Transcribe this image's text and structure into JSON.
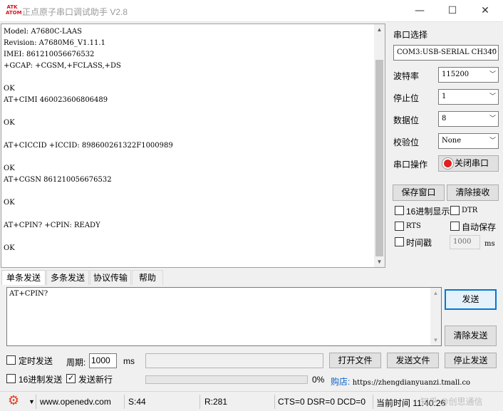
{
  "window": {
    "logo_text": "ATK ATOM",
    "title": "正点原子串口调试助手 V2.8",
    "minimize_icon": "minimize-icon",
    "maximize_icon": "maximize-icon",
    "close_icon": "close-icon"
  },
  "receive": {
    "lines": [
      "Model: A7680C-LAAS",
      "Revision: A7680M6_V1.11.1",
      "IMEI: 861210056676532",
      "+GCAP: +CGSM,+FCLASS,+DS",
      "",
      "OK",
      "AT+CIMI 460023606806489",
      "",
      "OK",
      "",
      "AT+CICCID +ICCID: 898600261322F1000989",
      "",
      "OK",
      "AT+CGSN 861210056676532",
      "",
      "OK",
      "",
      "AT+CPIN? +CPIN: READY",
      "",
      "OK"
    ]
  },
  "settings": {
    "port_label": "串口选择",
    "port_value": "COM3:USB-SERIAL CH340",
    "baud_label": "波特率",
    "baud_value": "115200",
    "stopbits_label": "停止位",
    "stopbits_value": "1",
    "databits_label": "数据位",
    "databits_value": "8",
    "parity_label": "校验位",
    "parity_value": "None",
    "serial_op_label": "串口操作",
    "close_port_button": "关闭串口",
    "save_window_button": "保存窗口",
    "clear_receive_button": "清除接收",
    "hex_display_label": "16进制显示",
    "dtr_label": "DTR",
    "rts_label": "RTS",
    "auto_save_label": "自动保存",
    "timestamp_label": "时间戳",
    "timestamp_value": "1000",
    "timestamp_unit": "ms"
  },
  "tabs": [
    {
      "label": "单条发送"
    },
    {
      "label": "多条发送"
    },
    {
      "label": "协议传输"
    },
    {
      "label": "帮助"
    }
  ],
  "send": {
    "text": "AT+CPIN?",
    "send_button": "发送",
    "clear_send_button": "清除发送",
    "timed_send_label": "定时发送",
    "period_label": "周期:",
    "period_value": "1000",
    "period_unit": "ms",
    "open_file_button": "打开文件",
    "send_file_button": "发送文件",
    "stop_send_button": "停止发送",
    "hex_send_label": "16进制发送",
    "send_newline_label": "发送新行",
    "progress_text": "0%",
    "progress_percent": 0,
    "shop_label": "购店:",
    "shop_url": "https://zhengdianyuanzi.tmall.co"
  },
  "status": {
    "website": "www.openedv.com",
    "sent": "S:44",
    "received": "R:281",
    "signals": "CTS=0 DSR=0 DCD=0",
    "current_time": "当前时间 11:40:26",
    "watermark": "知乎 @创思通信"
  }
}
